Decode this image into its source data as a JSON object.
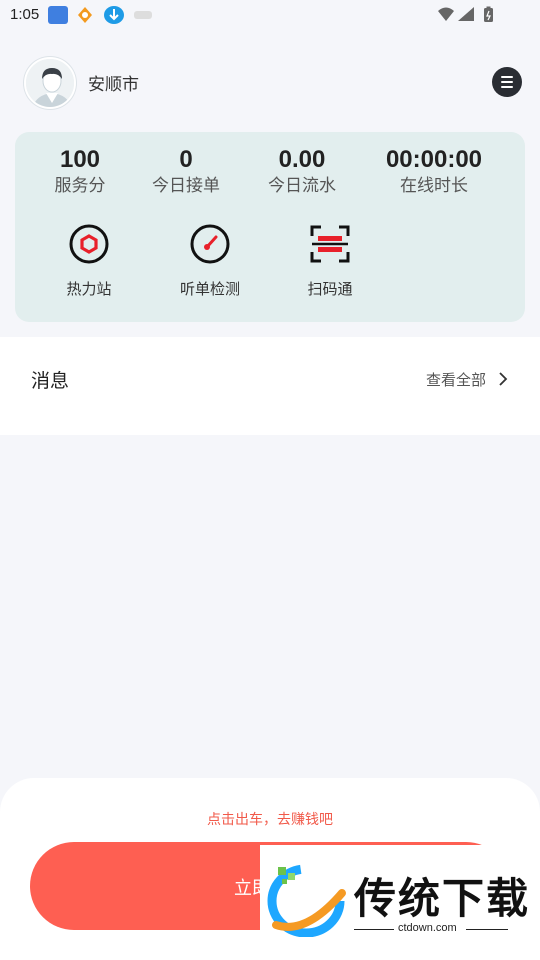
{
  "status_bar": {
    "time": "1:05",
    "icons": [
      "app-notification-icon",
      "app-notification-icon",
      "download-icon",
      "app-notification-icon",
      "wifi-icon",
      "signal-icon",
      "battery-icon"
    ]
  },
  "header": {
    "city": "安顺市",
    "menu_icon": "menu-lines-icon"
  },
  "stats": [
    {
      "value": "100",
      "label": "服务分"
    },
    {
      "value": "0",
      "label": "今日接单"
    },
    {
      "value": "0.00",
      "label": "今日流水"
    },
    {
      "value": "00:00:00",
      "label": "在线时长"
    }
  ],
  "tools": [
    {
      "label": "热力站",
      "icon": "hexagon-icon",
      "color": "#e8202a"
    },
    {
      "label": "听单检测",
      "icon": "gauge-icon",
      "color": "#e8202a"
    },
    {
      "label": "扫码通",
      "icon": "scan-icon",
      "color": "#e8202a"
    }
  ],
  "messages": {
    "title": "消息",
    "view_all": "查看全部"
  },
  "bottom": {
    "hint": "点击出车，去赚钱吧",
    "button_label": "立即出车"
  },
  "watermark": {
    "title": "传统下载",
    "url": "ctdown.com"
  },
  "colors": {
    "accent": "#fe5f52",
    "card_bg": "#e2eeee",
    "hint": "#f15a4a"
  }
}
